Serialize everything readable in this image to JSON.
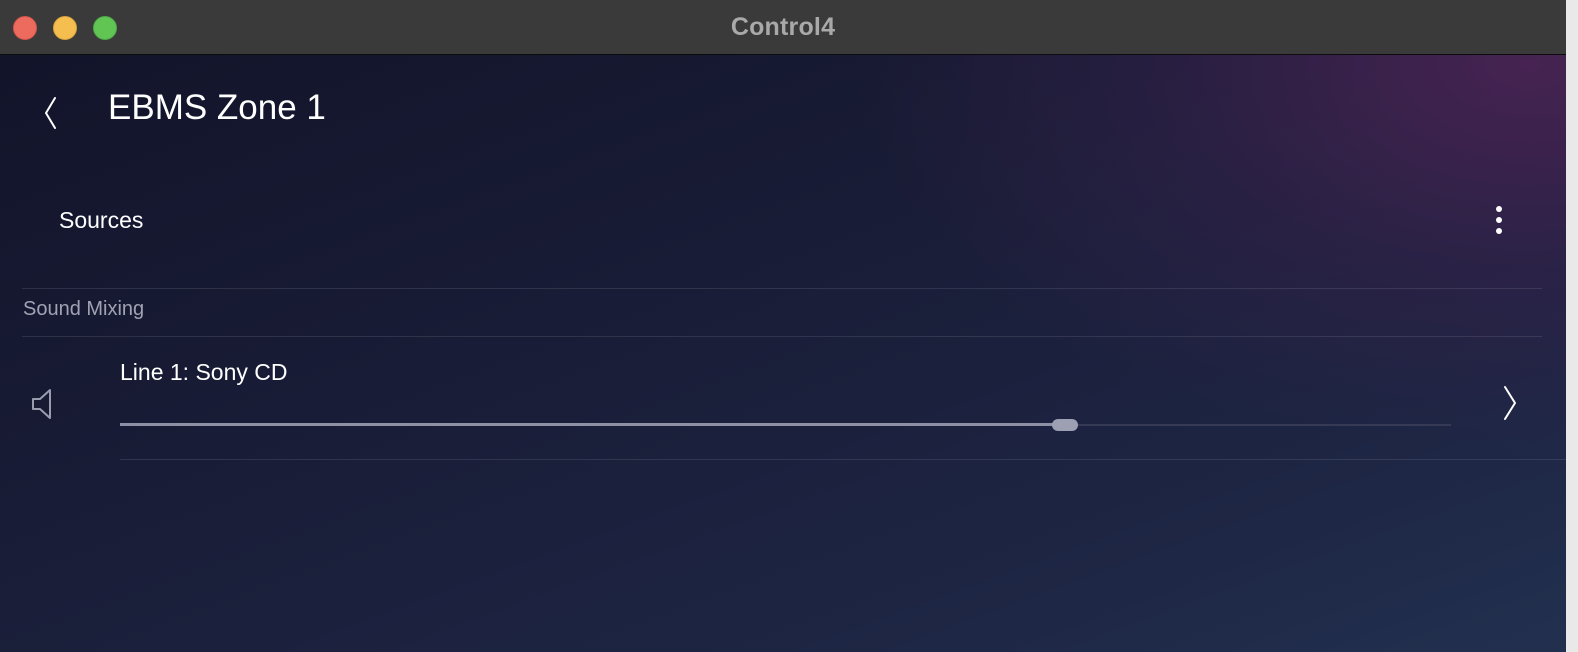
{
  "window": {
    "title": "Control4"
  },
  "header": {
    "back_icon": "chevron-left-icon",
    "title": "EBMS Zone 1"
  },
  "sources": {
    "label": "Sources",
    "more_icon": "more-vertical-icon"
  },
  "sound_mixing": {
    "section_label": "Sound Mixing",
    "items": [
      {
        "label": "Line 1: Sony CD",
        "icon": "speaker-icon",
        "volume_fraction": 0.71,
        "chevron_icon": "chevron-right-icon"
      }
    ]
  },
  "colors": {
    "background_start": "#12142a",
    "background_end": "#22304f",
    "accent_purple": "#4e2456",
    "text_primary": "#ffffff",
    "text_secondary": "#a0a3b3",
    "slider_fill": "#8e91a6",
    "slider_track": "#363a55"
  }
}
